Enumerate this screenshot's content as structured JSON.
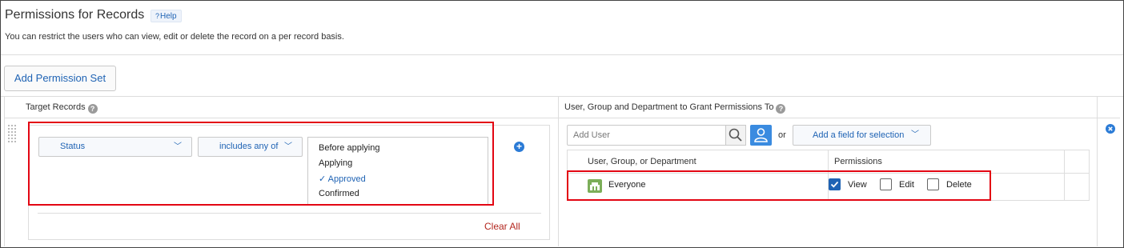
{
  "header": {
    "title": "Permissions for Records",
    "help_label": "Help",
    "description": "You can restrict the users who can view, edit or delete the record on a per record basis."
  },
  "toolbar": {
    "add_permission_set_label": "Add Permission Set"
  },
  "left": {
    "heading": "Target Records",
    "field_select": {
      "value": "Status"
    },
    "operator_select": {
      "value": "includes any of"
    },
    "options": [
      {
        "label": "Before applying",
        "selected": false
      },
      {
        "label": "Applying",
        "selected": false
      },
      {
        "label": "Approved",
        "selected": true
      },
      {
        "label": "Confirmed",
        "selected": false
      }
    ],
    "checkmark": "✓",
    "clear_all_label": "Clear All"
  },
  "right": {
    "heading": "User, Group and Department to Grant Permissions To",
    "add_user_placeholder": "Add User",
    "or_label": "or",
    "field_selection_label": "Add a field for selection",
    "table": {
      "col1": "User, Group, or Department",
      "col2": "Permissions",
      "rows": [
        {
          "name": "Everyone",
          "view_label": "View",
          "view": true,
          "edit_label": "Edit",
          "edit": false,
          "delete_label": "Delete",
          "delete": false
        }
      ]
    }
  },
  "colors": {
    "accent": "#1f63b4",
    "highlight_border": "#e30613",
    "clear_all": "#b3261e",
    "user_button": "#3a8be0",
    "everyone_icon": "#7cae59"
  }
}
